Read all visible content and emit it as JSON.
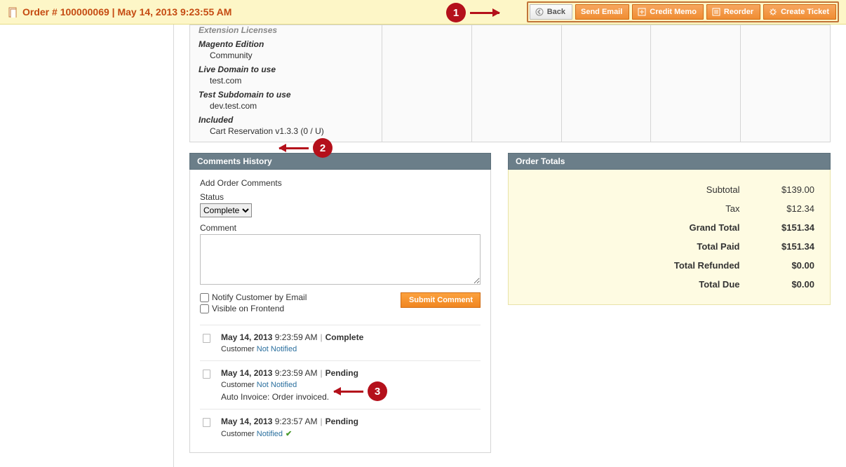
{
  "header": {
    "title": "Order # 100000069 | May 14, 2013 9:23:55 AM",
    "actions": {
      "back": "Back",
      "send_email": "Send Email",
      "credit_memo": "Credit Memo",
      "reorder": "Reorder",
      "create_ticket": "Create Ticket"
    }
  },
  "extension": {
    "section_title": "Extension Licenses",
    "edition_label": "Magento Edition",
    "edition_value": "Community",
    "live_domain_label": "Live Domain to use",
    "live_domain_value": "test.com",
    "test_subdomain_label": "Test Subdomain to use",
    "test_subdomain_value": "dev.test.com",
    "included_label": "Included",
    "included_value": "Cart Reservation v1.3.3 (0 / U)"
  },
  "comments": {
    "panel_title": "Comments History",
    "add_title": "Add Order Comments",
    "status_label": "Status",
    "status_selected": "Complete",
    "comment_label": "Comment",
    "notify_label": "Notify Customer by Email",
    "visible_label": "Visible on Frontend",
    "submit_label": "Submit Comment",
    "history": [
      {
        "date": "May 14, 2013",
        "time": "9:23:59 AM",
        "status": "Complete",
        "customer_prefix": "Customer",
        "customer_state": "Not Notified",
        "comment": "",
        "notified_ok": false
      },
      {
        "date": "May 14, 2013",
        "time": "9:23:59 AM",
        "status": "Pending",
        "customer_prefix": "Customer",
        "customer_state": "Not Notified",
        "comment": "Auto Invoice: Order invoiced.",
        "notified_ok": false
      },
      {
        "date": "May 14, 2013",
        "time": "9:23:57 AM",
        "status": "Pending",
        "customer_prefix": "Customer",
        "customer_state": "Notified",
        "comment": "",
        "notified_ok": true
      }
    ]
  },
  "totals": {
    "panel_title": "Order Totals",
    "rows": [
      {
        "label": "Subtotal",
        "value": "$139.00",
        "grand": false
      },
      {
        "label": "Tax",
        "value": "$12.34",
        "grand": false
      },
      {
        "label": "Grand Total",
        "value": "$151.34",
        "grand": true
      },
      {
        "label": "Total Paid",
        "value": "$151.34",
        "grand": true
      },
      {
        "label": "Total Refunded",
        "value": "$0.00",
        "grand": true
      },
      {
        "label": "Total Due",
        "value": "$0.00",
        "grand": true
      }
    ]
  },
  "callouts": {
    "c1": "1",
    "c2": "2",
    "c3": "3"
  }
}
